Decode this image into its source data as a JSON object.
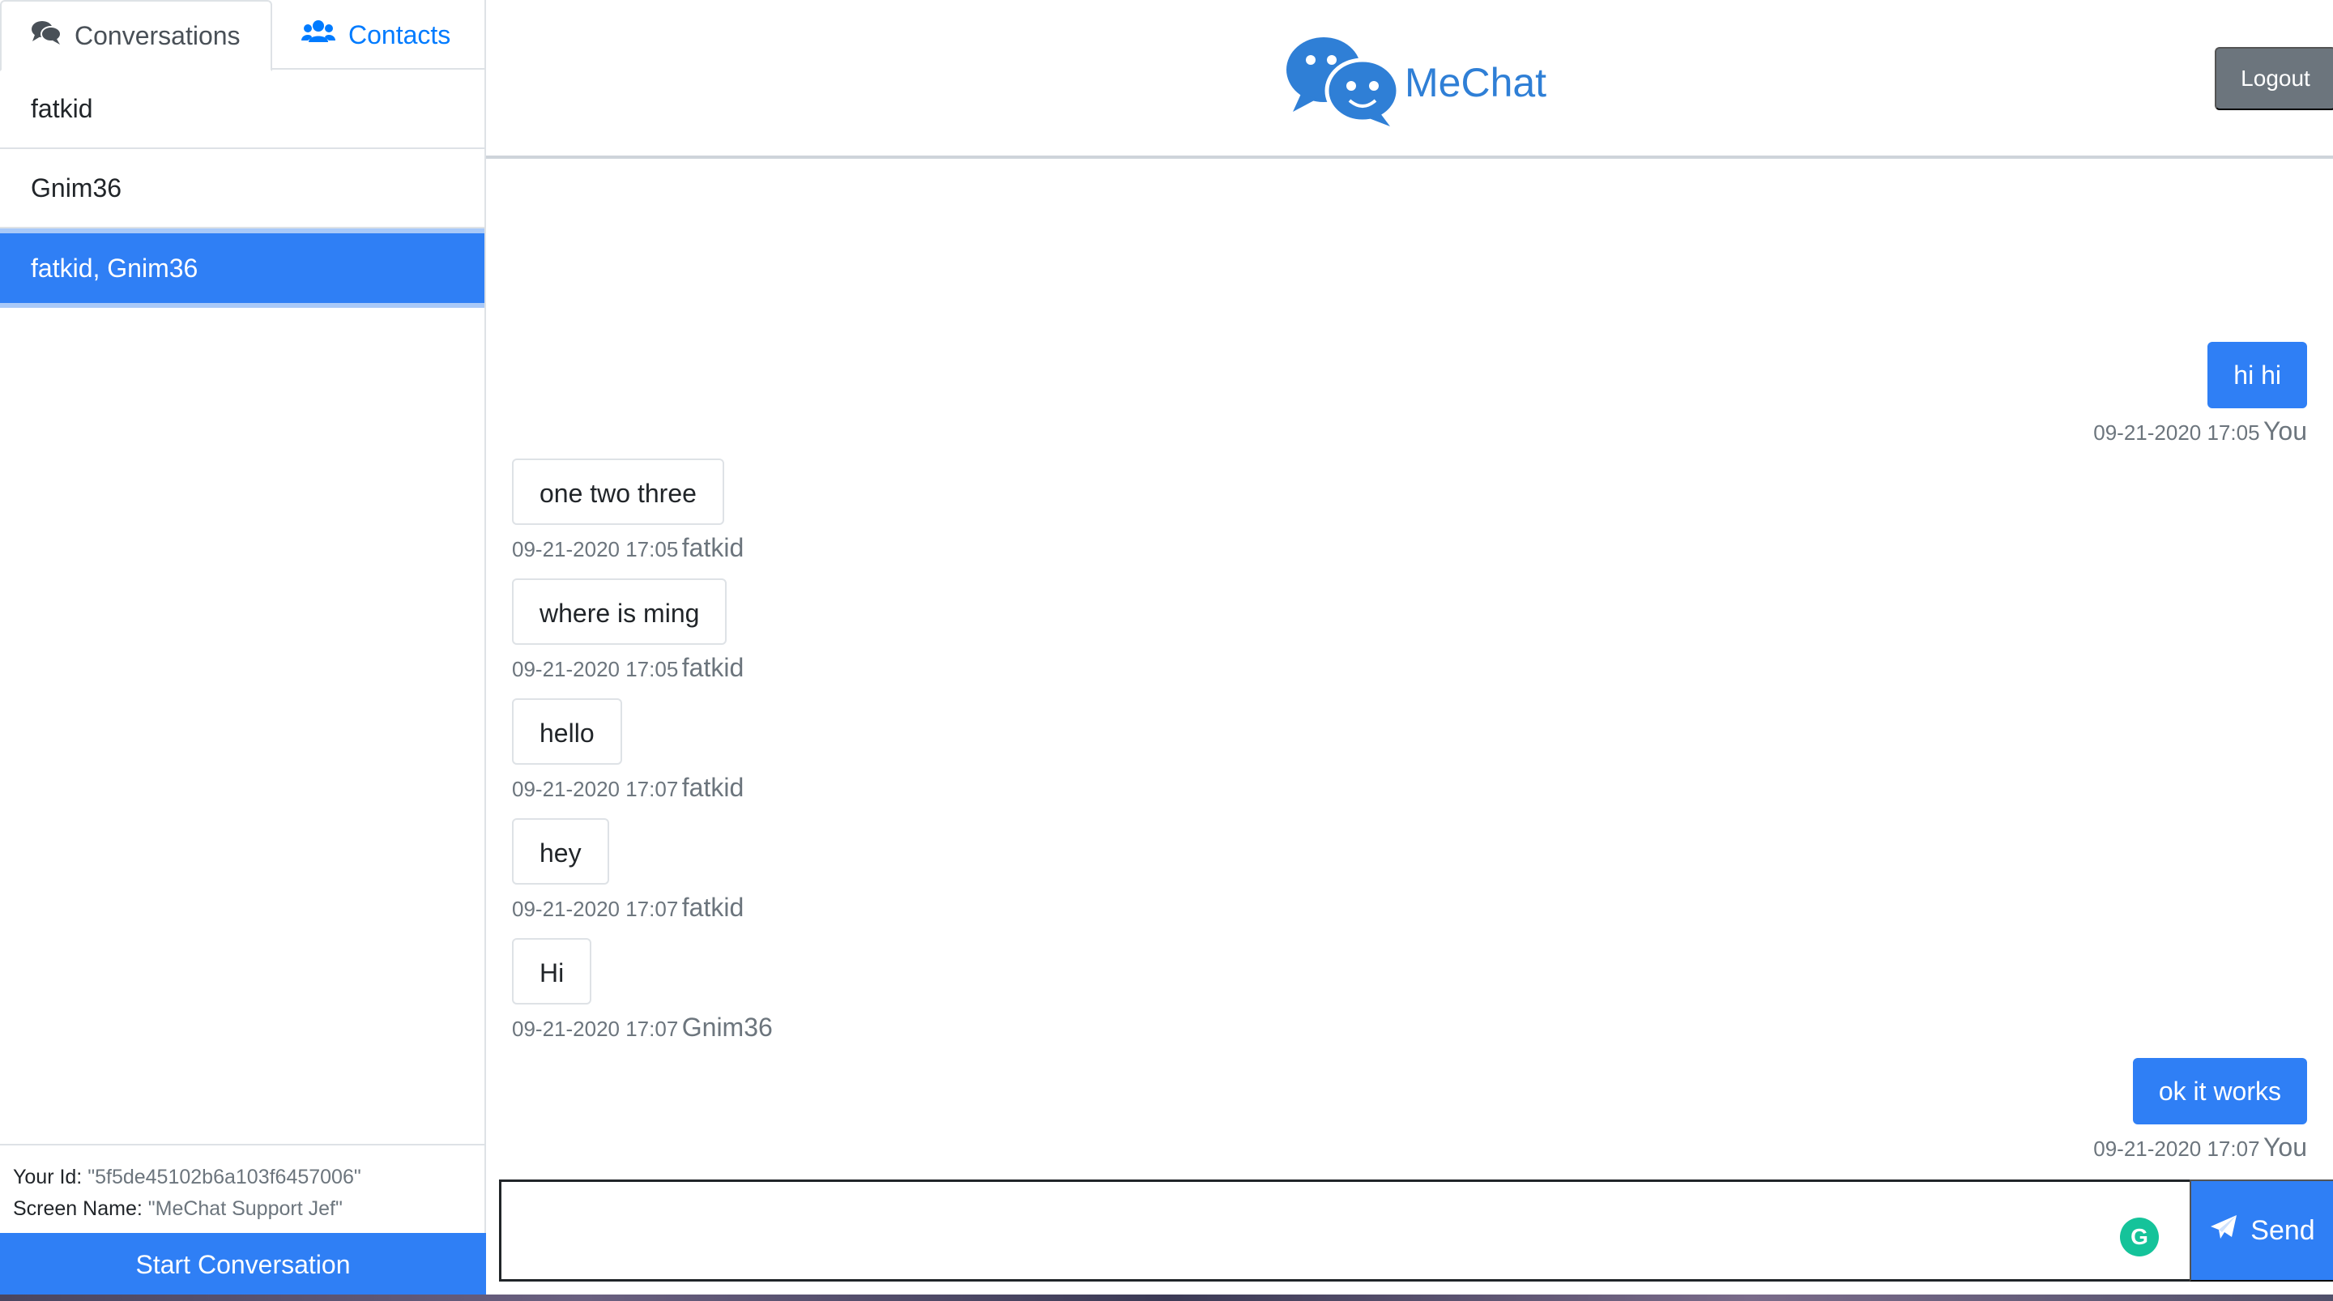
{
  "sidebar": {
    "tabs": [
      {
        "label": "Conversations",
        "icon": "comments-icon",
        "active": true
      },
      {
        "label": "Contacts",
        "icon": "users-icon",
        "active": false
      }
    ],
    "conversations": [
      {
        "label": "fatkid"
      },
      {
        "label": "Gnim36"
      },
      {
        "label": "fatkid, Gnim36",
        "active": true
      }
    ],
    "footer": {
      "id_label": "Your Id:",
      "id_value": "\"5f5de45102b6a103f6457006\"",
      "screen_name_label": "Screen Name:",
      "screen_name_value": "\"MeChat Support Jef\"",
      "start_button": "Start Conversation"
    }
  },
  "header": {
    "brand": "MeChat",
    "logout": "Logout"
  },
  "messages": [
    {
      "text": "hi hi",
      "time": "09-21-2020 17:05",
      "sender": "You",
      "mine": true
    },
    {
      "text": "one two three",
      "time": "09-21-2020 17:05",
      "sender": "fatkid",
      "mine": false
    },
    {
      "text": "where is ming",
      "time": "09-21-2020 17:05",
      "sender": "fatkid",
      "mine": false
    },
    {
      "text": "hello",
      "time": "09-21-2020 17:07",
      "sender": "fatkid",
      "mine": false
    },
    {
      "text": "hey",
      "time": "09-21-2020 17:07",
      "sender": "fatkid",
      "mine": false
    },
    {
      "text": "Hi",
      "time": "09-21-2020 17:07",
      "sender": "Gnim36",
      "mine": false
    },
    {
      "text": "ok it works",
      "time": "09-21-2020 17:07",
      "sender": "You",
      "mine": true
    }
  ],
  "composer": {
    "value": "",
    "placeholder": "",
    "send_label": "Send"
  },
  "colors": {
    "primary": "#2f7ff5",
    "brand": "#2f7fd6",
    "secondary": "#6c757d"
  }
}
